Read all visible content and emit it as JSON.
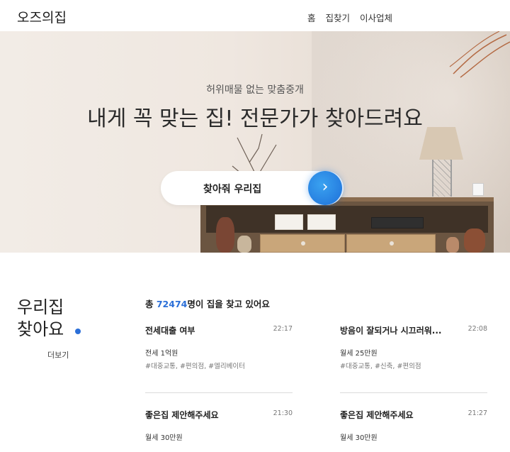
{
  "header": {
    "logo": "오즈의집",
    "nav": [
      "홈",
      "집찾기",
      "이사업체"
    ]
  },
  "hero": {
    "subtitle": "허위매물 없는 맞춤중개",
    "title": "내게 꼭 맞는 집! 전문가가 찾아드려요",
    "search_label": "찾아줘 우리집",
    "search_icon": "chevron-right-icon"
  },
  "section": {
    "title_line1": "우리집",
    "title_line2": "찾아요",
    "more": "더보기",
    "summary_prefix": "총 ",
    "summary_count": "72474",
    "summary_suffix": "명이 집을 찾고 있어요",
    "accent_color": "#2b6fd8"
  },
  "requests": [
    {
      "title": "전세대출 여부",
      "time": "22:17",
      "price": "전세 1억원",
      "tags": "#대중교통, #편의점, #엘리베이터"
    },
    {
      "title": "방음이 잘되거나 시끄러워...",
      "time": "22:08",
      "price": "월세 25만원",
      "tags": "#대중교통, #신축, #편의점"
    },
    {
      "title": "좋은집 제안해주세요",
      "time": "21:30",
      "price": "월세 30만원",
      "tags": ""
    },
    {
      "title": "좋은집 제안해주세요",
      "time": "21:27",
      "price": "월세 30만원",
      "tags": ""
    }
  ]
}
